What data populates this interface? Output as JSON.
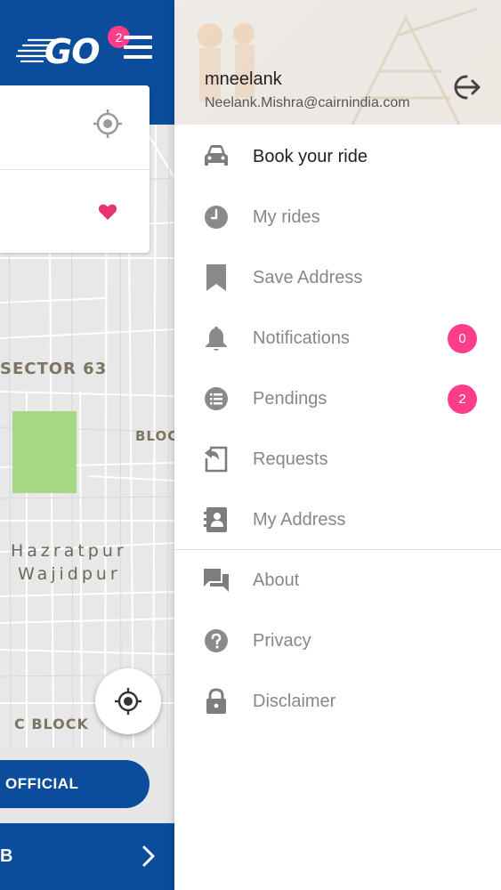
{
  "app": {
    "logo_text": "GO",
    "notification_count": "2"
  },
  "map": {
    "labels": {
      "sector": "SECTOR 63",
      "bloc": "BLOC",
      "hazrat_line1": "Hazratpur",
      "hazrat_line2": "Wajidpur",
      "cblock": "C BLOCK"
    }
  },
  "actions": {
    "official_label": "OFFICIAL",
    "bottom_bar_text": "B"
  },
  "drawer": {
    "username": "mneelank",
    "email": "Neelank.Mishra@cairnindia.com",
    "items": [
      {
        "label": "Book your ride",
        "icon": "car-icon"
      },
      {
        "label": "My rides",
        "icon": "clock-icon"
      },
      {
        "label": "Save Address",
        "icon": "bookmark-icon"
      },
      {
        "label": "Notifications",
        "icon": "bell-icon",
        "badge": "0"
      },
      {
        "label": "Pendings",
        "icon": "list-icon",
        "badge": "2"
      },
      {
        "label": "Requests",
        "icon": "requests-icon"
      },
      {
        "label": "My Address",
        "icon": "contacts-icon"
      },
      {
        "label": "About",
        "icon": "chat-icon"
      },
      {
        "label": "Privacy",
        "icon": "help-icon"
      },
      {
        "label": "Disclaimer",
        "icon": "lock-icon"
      }
    ]
  },
  "colors": {
    "brand_blue": "#0b4d9c",
    "badge_pink": "#ff3d8b",
    "icon_gray": "#8a8a8a"
  }
}
